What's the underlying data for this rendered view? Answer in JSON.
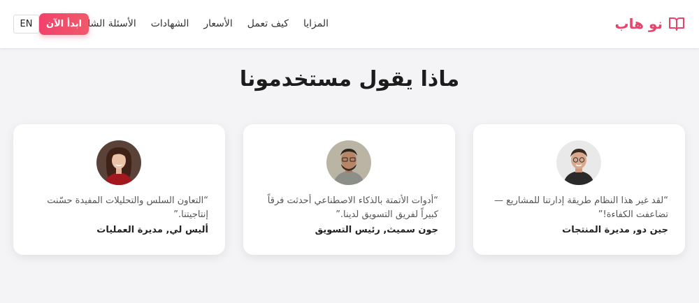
{
  "header": {
    "brand": "نو هاب",
    "brand_icon": "book-open-icon",
    "brand_color": "#e8436a",
    "nav": [
      "المزايا",
      "كيف تعمل",
      "الأسعار",
      "الشهادات",
      "الأسئلة الشائعة"
    ],
    "cta_label": "ابدأ الآن",
    "lang_label": "EN"
  },
  "testimonials": {
    "title": "ماذا يقول مستخدمونا",
    "items": [
      {
        "quote": "“لقد غير هذا النظام طريقة إدارتنا للمشاريع — تضاعفت الكفاءة!”",
        "author": "جين دو, مديرة المنتجات"
      },
      {
        "quote": "“أدوات الأتمتة بالذكاء الاصطناعي أحدثت فرقاً كبيراً لفريق التسويق لدينا.”",
        "author": "جون سميث, رئيس التسويق"
      },
      {
        "quote": "“التعاون السلس والتحليلات المفيدة حسّنت إنتاجيتنا.”",
        "author": "أليس لي, مديرة العمليات"
      }
    ]
  }
}
